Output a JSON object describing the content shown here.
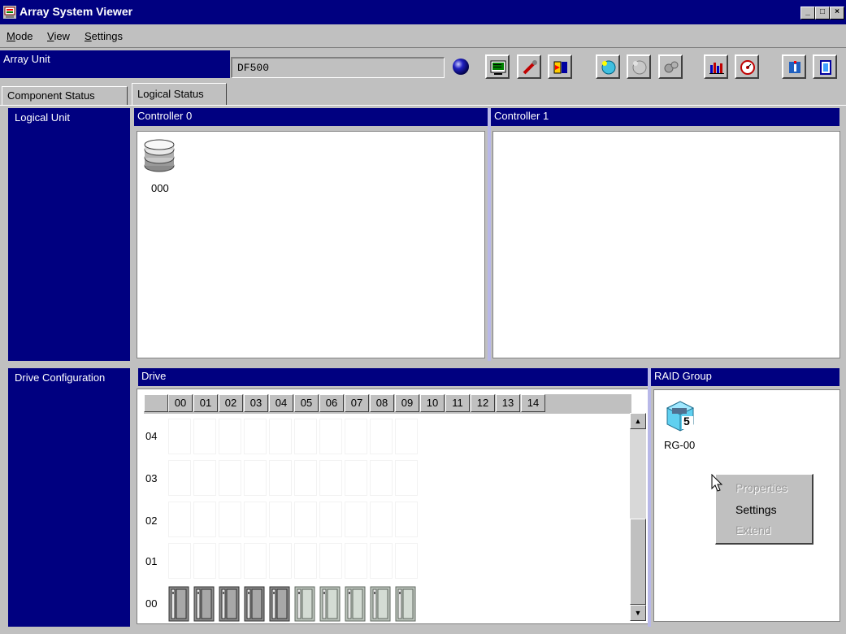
{
  "window": {
    "title": "Array System Viewer"
  },
  "menu": [
    {
      "label": "Mode",
      "mnemonic": "M",
      "rest": "ode"
    },
    {
      "label": "View",
      "mnemonic": "V",
      "rest": "iew"
    },
    {
      "label": "Settings",
      "mnemonic": "S",
      "rest": "ettings"
    }
  ],
  "array_unit": {
    "label": "Array Unit",
    "value": "DF500"
  },
  "toolbar_icons": [
    "status-lamp-icon",
    "monitor-icon",
    "wrench-icon",
    "swap-icon",
    "new-cube-icon",
    "cube-icon",
    "gears-icon",
    "bar-chart-icon",
    "clock-dial-icon",
    "info-icon",
    "exit-icon"
  ],
  "tabs": {
    "component_status": "Component Status",
    "logical_status": "Logical Status"
  },
  "logical_unit": {
    "section_label": "Logical Unit",
    "controller0": {
      "label": "Controller 0",
      "units": [
        "000"
      ]
    },
    "controller1": {
      "label": "Controller 1"
    }
  },
  "drive_configuration": {
    "section_label": "Drive Configuration",
    "drive_label": "Drive",
    "columns": [
      "00",
      "01",
      "02",
      "03",
      "04",
      "05",
      "06",
      "07",
      "08",
      "09",
      "10",
      "11",
      "12",
      "13",
      "14"
    ],
    "rows": [
      "04",
      "03",
      "02",
      "01",
      "00"
    ],
    "row00_drives": [
      "dark",
      "dark",
      "dark",
      "dark",
      "dark",
      "light",
      "light",
      "light",
      "light",
      "light"
    ]
  },
  "raid_group": {
    "label": "RAID Group",
    "group_name": "RG-00",
    "raid_level": "5"
  },
  "context_menu": {
    "properties": "Properties",
    "settings": "Settings",
    "extend": "Extend"
  },
  "colors": {
    "title_bar": "#000080",
    "panel_header": "#000080",
    "face": "#c0c0c0"
  }
}
